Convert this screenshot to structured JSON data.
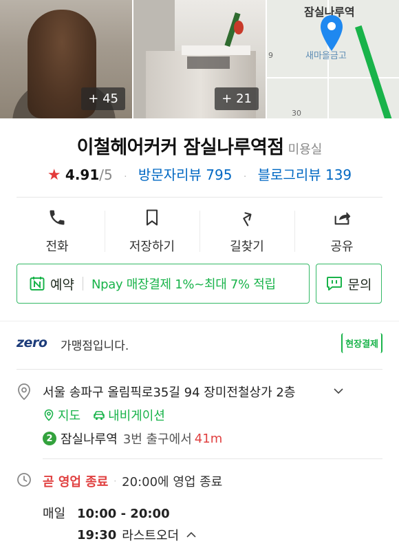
{
  "photos": {
    "count1": "+ 45",
    "count2": "+ 21",
    "map": {
      "station_label": "잠실나루역",
      "poi_label": "새마을금고",
      "numbers": [
        "9",
        "30"
      ]
    }
  },
  "place": {
    "name": "이철헤어커커 잠실나루역점",
    "category": "미용실",
    "rating": "4.91",
    "rating_max": "/5",
    "visitor_review": "방문자리뷰 795",
    "blog_review": "블로그리뷰 139"
  },
  "actions": [
    {
      "label": "전화",
      "icon": "phone-icon"
    },
    {
      "label": "저장하기",
      "icon": "bookmark-icon"
    },
    {
      "label": "길찾기",
      "icon": "directions-icon"
    },
    {
      "label": "공유",
      "icon": "share-icon"
    }
  ],
  "booking": {
    "label": "예약",
    "pay_text": "Npay 매장결제 1%~최대 7% 적립",
    "ask_label": "문의"
  },
  "zero": {
    "logo": "zero",
    "text": "가맹점입니다.",
    "badge": "현장결제"
  },
  "address": {
    "text": "서울 송파구 올림픽로35길 94 장미전철상가 2층",
    "map_link": "지도",
    "nav_link": "내비게이션",
    "subway_line": "2",
    "subway_station": "잠실나루역",
    "subway_exit": "3번 출구에서",
    "subway_distance": "41m"
  },
  "hours": {
    "status": "곧 영업 종료",
    "note": "20:00에 영업 종료",
    "day": "매일",
    "time": "10:00 - 20:00",
    "last_order_time": "19:30",
    "last_order_label": "라스트오더"
  },
  "colors": {
    "accent_green": "#19b34a",
    "review_blue": "#0068c3",
    "star_red": "#e33a3a",
    "closing_red": "#e04040",
    "line2_green": "#33a23d"
  }
}
